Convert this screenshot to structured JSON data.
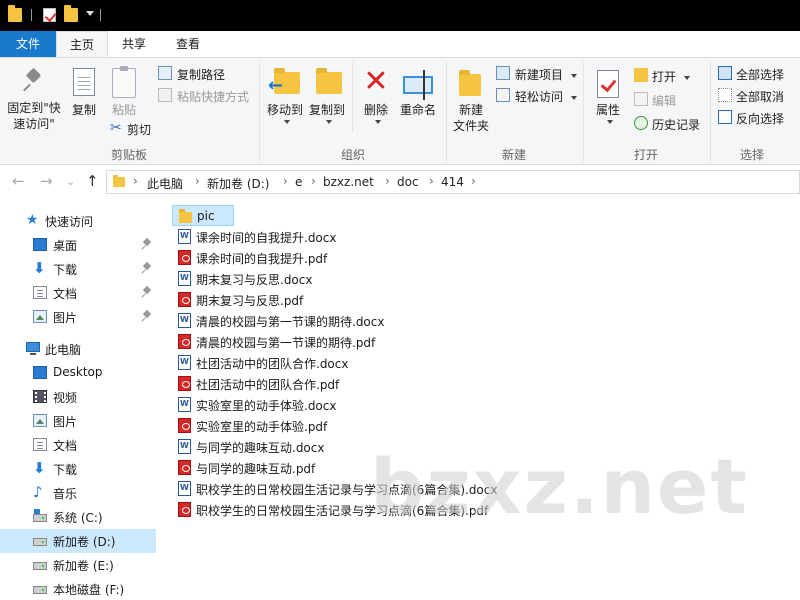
{
  "ribbon_tabs": {
    "file": "文件",
    "home": "主页",
    "share": "共享",
    "view": "查看"
  },
  "clipboard": {
    "pin_line1": "固定到\"快",
    "pin_line2": "速访问\"",
    "copy": "复制",
    "paste": "粘贴",
    "copy_path": "复制路径",
    "paste_shortcut": "粘贴快捷方式",
    "cut": "剪切",
    "group": "剪贴板"
  },
  "organize": {
    "move_to": "移动到",
    "copy_to": "复制到",
    "delete": "删除",
    "rename": "重命名",
    "group": "组织"
  },
  "new_group": {
    "new_folder_line1": "新建",
    "new_folder_line2": "文件夹",
    "new_item": "新建项目",
    "easy_access": "轻松访问",
    "group": "新建"
  },
  "open_group": {
    "properties": "属性",
    "open": "打开",
    "edit": "编辑",
    "history": "历史记录",
    "group": "打开"
  },
  "select_group": {
    "select_all": "全部选择",
    "select_none": "全部取消",
    "invert": "反向选择",
    "group": "选择"
  },
  "nav_buttons": {
    "back": "←",
    "forward": "→",
    "recent": "⌄",
    "up": "↑"
  },
  "breadcrumb": [
    "此电脑",
    "新加卷 (D:)",
    "e",
    "bzxz.net",
    "doc",
    "414"
  ],
  "nav_pane": {
    "quick_access": "快速访问",
    "qa_items": [
      "桌面",
      "下载",
      "文档",
      "图片"
    ],
    "this_pc": "此电脑",
    "pc_items": [
      "Desktop",
      "视频",
      "图片",
      "文档",
      "下载",
      "音乐"
    ],
    "drives": [
      "系统 (C:)",
      "新加卷 (D:)",
      "新加卷 (E:)",
      "本地磁盘 (F:)"
    ]
  },
  "files": [
    {
      "name": "pic",
      "type": "folder"
    },
    {
      "name": "课余时间的自我提升.docx",
      "type": "word"
    },
    {
      "name": "课余时间的自我提升.pdf",
      "type": "pdf"
    },
    {
      "name": "期末复习与反思.docx",
      "type": "word"
    },
    {
      "name": "期末复习与反思.pdf",
      "type": "pdf"
    },
    {
      "name": "清晨的校园与第一节课的期待.docx",
      "type": "word"
    },
    {
      "name": "清晨的校园与第一节课的期待.pdf",
      "type": "pdf"
    },
    {
      "name": "社团活动中的团队合作.docx",
      "type": "word"
    },
    {
      "name": "社团活动中的团队合作.pdf",
      "type": "pdf"
    },
    {
      "name": "实验室里的动手体验.docx",
      "type": "word"
    },
    {
      "name": "实验室里的动手体验.pdf",
      "type": "pdf"
    },
    {
      "name": "与同学的趣味互动.docx",
      "type": "word"
    },
    {
      "name": "与同学的趣味互动.pdf",
      "type": "pdf"
    },
    {
      "name": "职校学生的日常校园生活记录与学习点滴(6篇合集).docx",
      "type": "word"
    },
    {
      "name": "职校学生的日常校园生活记录与学习点滴(6篇合集).pdf",
      "type": "pdf"
    }
  ],
  "watermark": "bzxz.net",
  "colors": {
    "accent": "#1979ca",
    "selection": "#cce8ff",
    "folder": "#f5c542",
    "pdf": "#d62828",
    "word": "#2b5797"
  }
}
